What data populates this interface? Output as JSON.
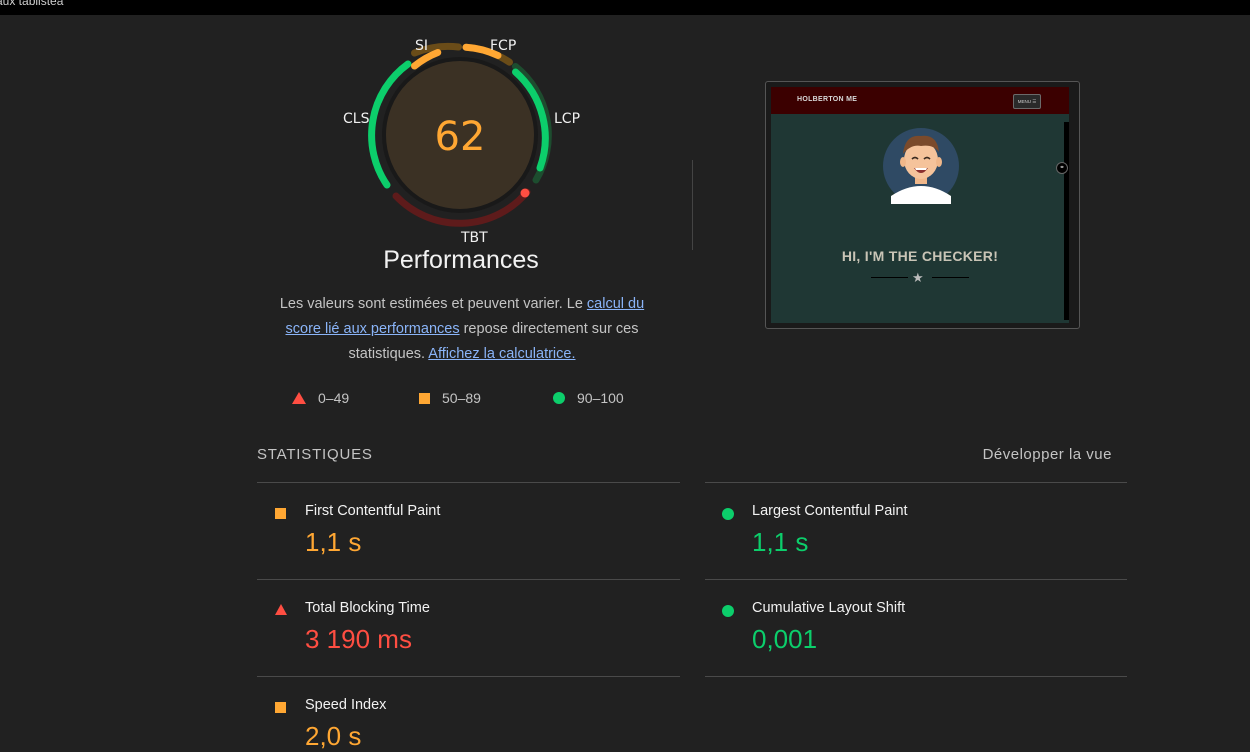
{
  "window": {
    "title_fragment": "aux tablistea"
  },
  "gauge": {
    "score": "62",
    "title": "Performances",
    "labels": {
      "si": "SI",
      "fcp": "FCP",
      "lcp": "LCP",
      "tbt": "TBT",
      "cls": "CLS"
    },
    "colors": {
      "orange": "#ffa733",
      "green": "#0cce6b",
      "red": "#ff4e42",
      "fill": "#3b3124"
    }
  },
  "description": {
    "part1": "Les valeurs sont estimées et peuvent varier. Le ",
    "link1": "calcul du score lié aux performances",
    "part2": " repose directement sur ces statistiques. ",
    "link2": "Affichez la calculatrice."
  },
  "legend": [
    {
      "icon": "triangle-icon",
      "range": "0–49",
      "color": "#ff4e42"
    },
    {
      "icon": "square-icon",
      "range": "50–89",
      "color": "#ffa733"
    },
    {
      "icon": "circle-icon",
      "range": "90–100",
      "color": "#0cce6b"
    }
  ],
  "screenshot": {
    "brand": "HOLBERTON ME",
    "menu_label": "MENU ☰",
    "heading": "HI, I'M THE CHECKER!"
  },
  "statistics": {
    "title": "STATISTIQUES",
    "expand_label": "Développer la vue",
    "metrics": [
      {
        "name": "First Contentful Paint",
        "value": "1,1 s",
        "status": "average",
        "icon": "square-icon"
      },
      {
        "name": "Largest Contentful Paint",
        "value": "1,1 s",
        "status": "pass",
        "icon": "circle-icon"
      },
      {
        "name": "Total Blocking Time",
        "value": "3 190 ms",
        "status": "fail",
        "icon": "triangle-icon"
      },
      {
        "name": "Cumulative Layout Shift",
        "value": "0,001",
        "status": "pass",
        "icon": "circle-icon"
      },
      {
        "name": "Speed Index",
        "value": "2,0 s",
        "status": "average",
        "icon": "square-icon"
      }
    ]
  }
}
